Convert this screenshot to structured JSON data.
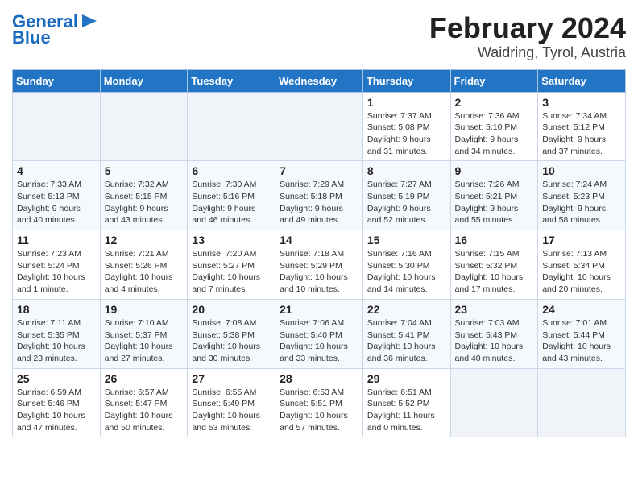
{
  "logo": {
    "line1": "General",
    "line2": "Blue"
  },
  "title": "February 2024",
  "subtitle": "Waidring, Tyrol, Austria",
  "days_of_week": [
    "Sunday",
    "Monday",
    "Tuesday",
    "Wednesday",
    "Thursday",
    "Friday",
    "Saturday"
  ],
  "weeks": [
    [
      {
        "day": "",
        "info": ""
      },
      {
        "day": "",
        "info": ""
      },
      {
        "day": "",
        "info": ""
      },
      {
        "day": "",
        "info": ""
      },
      {
        "day": "1",
        "info": "Sunrise: 7:37 AM\nSunset: 5:08 PM\nDaylight: 9 hours and 31 minutes."
      },
      {
        "day": "2",
        "info": "Sunrise: 7:36 AM\nSunset: 5:10 PM\nDaylight: 9 hours and 34 minutes."
      },
      {
        "day": "3",
        "info": "Sunrise: 7:34 AM\nSunset: 5:12 PM\nDaylight: 9 hours and 37 minutes."
      }
    ],
    [
      {
        "day": "4",
        "info": "Sunrise: 7:33 AM\nSunset: 5:13 PM\nDaylight: 9 hours and 40 minutes."
      },
      {
        "day": "5",
        "info": "Sunrise: 7:32 AM\nSunset: 5:15 PM\nDaylight: 9 hours and 43 minutes."
      },
      {
        "day": "6",
        "info": "Sunrise: 7:30 AM\nSunset: 5:16 PM\nDaylight: 9 hours and 46 minutes."
      },
      {
        "day": "7",
        "info": "Sunrise: 7:29 AM\nSunset: 5:18 PM\nDaylight: 9 hours and 49 minutes."
      },
      {
        "day": "8",
        "info": "Sunrise: 7:27 AM\nSunset: 5:19 PM\nDaylight: 9 hours and 52 minutes."
      },
      {
        "day": "9",
        "info": "Sunrise: 7:26 AM\nSunset: 5:21 PM\nDaylight: 9 hours and 55 minutes."
      },
      {
        "day": "10",
        "info": "Sunrise: 7:24 AM\nSunset: 5:23 PM\nDaylight: 9 hours and 58 minutes."
      }
    ],
    [
      {
        "day": "11",
        "info": "Sunrise: 7:23 AM\nSunset: 5:24 PM\nDaylight: 10 hours and 1 minute."
      },
      {
        "day": "12",
        "info": "Sunrise: 7:21 AM\nSunset: 5:26 PM\nDaylight: 10 hours and 4 minutes."
      },
      {
        "day": "13",
        "info": "Sunrise: 7:20 AM\nSunset: 5:27 PM\nDaylight: 10 hours and 7 minutes."
      },
      {
        "day": "14",
        "info": "Sunrise: 7:18 AM\nSunset: 5:29 PM\nDaylight: 10 hours and 10 minutes."
      },
      {
        "day": "15",
        "info": "Sunrise: 7:16 AM\nSunset: 5:30 PM\nDaylight: 10 hours and 14 minutes."
      },
      {
        "day": "16",
        "info": "Sunrise: 7:15 AM\nSunset: 5:32 PM\nDaylight: 10 hours and 17 minutes."
      },
      {
        "day": "17",
        "info": "Sunrise: 7:13 AM\nSunset: 5:34 PM\nDaylight: 10 hours and 20 minutes."
      }
    ],
    [
      {
        "day": "18",
        "info": "Sunrise: 7:11 AM\nSunset: 5:35 PM\nDaylight: 10 hours and 23 minutes."
      },
      {
        "day": "19",
        "info": "Sunrise: 7:10 AM\nSunset: 5:37 PM\nDaylight: 10 hours and 27 minutes."
      },
      {
        "day": "20",
        "info": "Sunrise: 7:08 AM\nSunset: 5:38 PM\nDaylight: 10 hours and 30 minutes."
      },
      {
        "day": "21",
        "info": "Sunrise: 7:06 AM\nSunset: 5:40 PM\nDaylight: 10 hours and 33 minutes."
      },
      {
        "day": "22",
        "info": "Sunrise: 7:04 AM\nSunset: 5:41 PM\nDaylight: 10 hours and 36 minutes."
      },
      {
        "day": "23",
        "info": "Sunrise: 7:03 AM\nSunset: 5:43 PM\nDaylight: 10 hours and 40 minutes."
      },
      {
        "day": "24",
        "info": "Sunrise: 7:01 AM\nSunset: 5:44 PM\nDaylight: 10 hours and 43 minutes."
      }
    ],
    [
      {
        "day": "25",
        "info": "Sunrise: 6:59 AM\nSunset: 5:46 PM\nDaylight: 10 hours and 47 minutes."
      },
      {
        "day": "26",
        "info": "Sunrise: 6:57 AM\nSunset: 5:47 PM\nDaylight: 10 hours and 50 minutes."
      },
      {
        "day": "27",
        "info": "Sunrise: 6:55 AM\nSunset: 5:49 PM\nDaylight: 10 hours and 53 minutes."
      },
      {
        "day": "28",
        "info": "Sunrise: 6:53 AM\nSunset: 5:51 PM\nDaylight: 10 hours and 57 minutes."
      },
      {
        "day": "29",
        "info": "Sunrise: 6:51 AM\nSunset: 5:52 PM\nDaylight: 11 hours and 0 minutes."
      },
      {
        "day": "",
        "info": ""
      },
      {
        "day": "",
        "info": ""
      }
    ]
  ]
}
